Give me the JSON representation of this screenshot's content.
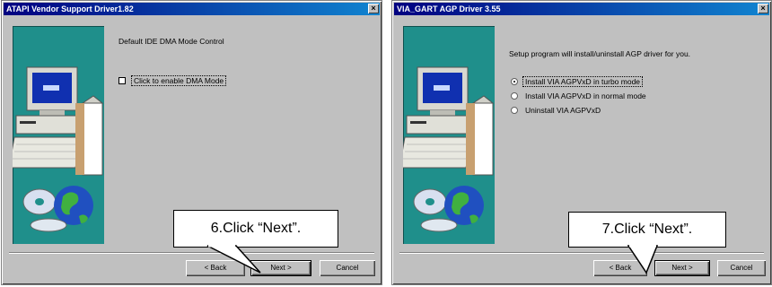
{
  "left_window": {
    "title": "ATAPI Vendor Support Driver1.82",
    "heading": "Default IDE DMA Mode Control",
    "checkbox_label": "Click to enable DMA Mode",
    "checkbox_checked": false,
    "back_label": "< Back",
    "next_label": "Next >",
    "cancel_label": "Cancel",
    "callout_text": "6.Click “Next”."
  },
  "right_window": {
    "title": "VIA_GART AGP Driver 3.55",
    "heading": "Setup program will install/uninstall AGP driver for you.",
    "options": [
      {
        "label": "Install VIA AGPVxD in turbo mode",
        "selected": true
      },
      {
        "label": "Install VIA AGPVxD in normal mode",
        "selected": false
      },
      {
        "label": "Uninstall VIA AGPVxD",
        "selected": false
      }
    ],
    "back_label": "< Back",
    "next_label": "Next >",
    "cancel_label": "Cancel",
    "callout_text": "7.Click “Next”."
  },
  "icons": {
    "left_illustration": "computer-cd-globe-icon",
    "right_illustration": "computer-cd-globe-icon",
    "close": "close-icon"
  },
  "colors": {
    "titlebar": "#000080",
    "panel": "#1f8f8b",
    "dialog": "#c0c0c0"
  }
}
